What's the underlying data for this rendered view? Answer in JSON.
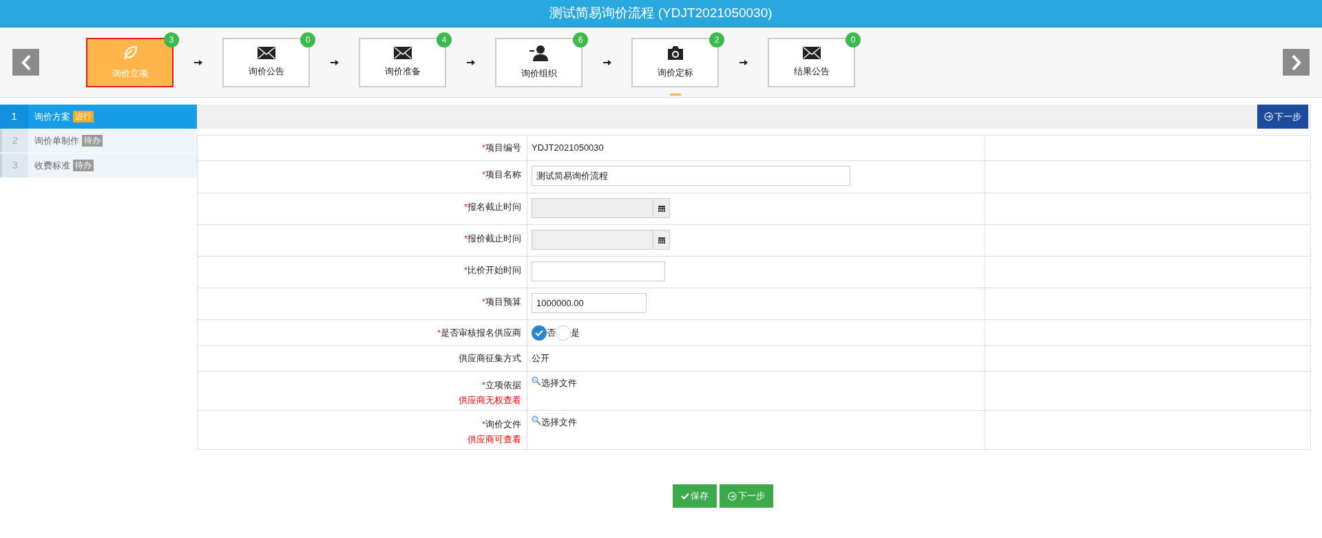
{
  "header": {
    "title": "测试简易询价流程 (YDJT2021050030)"
  },
  "steps": [
    {
      "label": "询价立项",
      "count": "3",
      "kind": "leaf",
      "selected": true,
      "underline": false
    },
    {
      "label": "询价公告",
      "count": "0",
      "kind": "envelope",
      "selected": false,
      "underline": false
    },
    {
      "label": "询价准备",
      "count": "4",
      "kind": "envelope",
      "selected": false,
      "underline": false
    },
    {
      "label": "询价组织",
      "count": "6",
      "kind": "user",
      "selected": false,
      "underline": false
    },
    {
      "label": "询价定标",
      "count": "2",
      "kind": "camera",
      "selected": false,
      "underline": true
    },
    {
      "label": "结果公告",
      "count": "0",
      "kind": "envelope",
      "selected": false,
      "underline": false
    }
  ],
  "sidebar": {
    "items": [
      {
        "number": "1",
        "label": "询价方案",
        "status": "进行",
        "selected": true
      },
      {
        "number": "2",
        "label": "询价单制作",
        "status": "待办",
        "selected": false
      },
      {
        "number": "3",
        "label": "收费标准",
        "status": "待办",
        "selected": false
      }
    ]
  },
  "toolbar": {
    "next_button": "下一步"
  },
  "form": {
    "rows": [
      {
        "kind": "text",
        "marker": "*",
        "label": "项目编号",
        "value": "YDJT2021050030"
      },
      {
        "kind": "input",
        "marker": "*",
        "label": "项目名称",
        "value": "测试简易询价流程"
      },
      {
        "kind": "date",
        "marker": "*",
        "label": "报名截止时间",
        "disabled": true
      },
      {
        "kind": "date",
        "marker": "*",
        "label": "报价截止时间",
        "disabled": true
      },
      {
        "kind": "input",
        "marker": "*",
        "label": "比价开始时间"
      },
      {
        "kind": "input",
        "marker": "*",
        "label": "项目预算",
        "value": "1000000.00"
      },
      {
        "kind": "radio",
        "marker": "*",
        "label": "是否审核报名供应商",
        "options": [
          {
            "label": "否",
            "selected": true
          },
          {
            "label": "是",
            "selected": false
          }
        ]
      },
      {
        "kind": "text",
        "label": "供应商征集方式",
        "value": "公开"
      },
      {
        "kind": "file",
        "marker": "*",
        "label": "立项依据",
        "note": "供应商无权查看",
        "button": "选择文件"
      },
      {
        "kind": "file",
        "marker": "*",
        "label": "询价文件",
        "note": "供应商可查看",
        "button": "选择文件"
      }
    ]
  },
  "footer_buttons": [
    {
      "kind": "save",
      "label": "保存"
    },
    {
      "kind": "next",
      "label": "下一步"
    }
  ]
}
